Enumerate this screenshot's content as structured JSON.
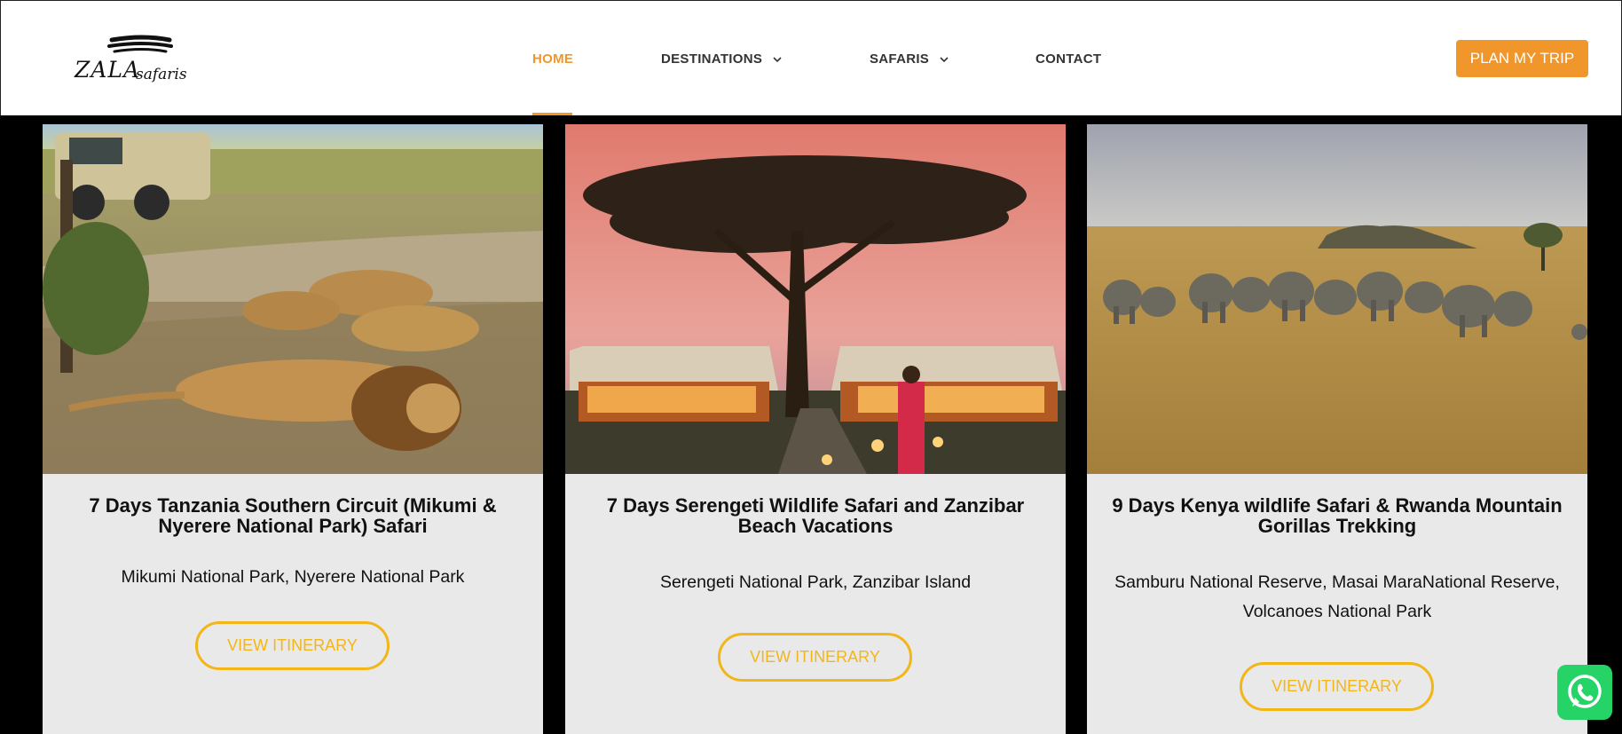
{
  "header": {
    "logo_text": "ZALA SAFARIS",
    "nav": [
      {
        "label": "HOME",
        "active": true
      },
      {
        "label": "DESTINATIONS",
        "dropdown": true
      },
      {
        "label": "SAFARIS",
        "dropdown": true
      },
      {
        "label": "CONTACT"
      }
    ],
    "cta_label": "PLAN MY TRIP"
  },
  "cards": [
    {
      "image": "lions-resting-near-safari-jeep",
      "title": "7 Days Tanzania Southern Circuit (Mikumi & Nyerere National Park) Safari",
      "subtitle": "Mikumi National Park, Nyerere National Park",
      "button": "VIEW ITINERARY"
    },
    {
      "image": "acacia-tree-tented-camp-sunset",
      "title": "7 Days Serengeti Wildlife Safari and Zanzibar Beach Vacations",
      "subtitle": "Serengeti National Park, Zanzibar Island",
      "button": "VIEW ITINERARY"
    },
    {
      "image": "elephant-herd-savanna",
      "title": "9 Days Kenya wildlife Safari & Rwanda Mountain Gorillas Trekking",
      "subtitle": "Samburu National Reserve, Masai MaraNational Reserve, Volcanoes National Park",
      "button": "VIEW ITINERARY"
    }
  ],
  "colors": {
    "accent": "#f0962a",
    "button_outline": "#f2b619",
    "card_bg": "#e9e9e9",
    "whatsapp": "#25d366"
  },
  "floating": {
    "icon": "whatsapp-icon"
  }
}
